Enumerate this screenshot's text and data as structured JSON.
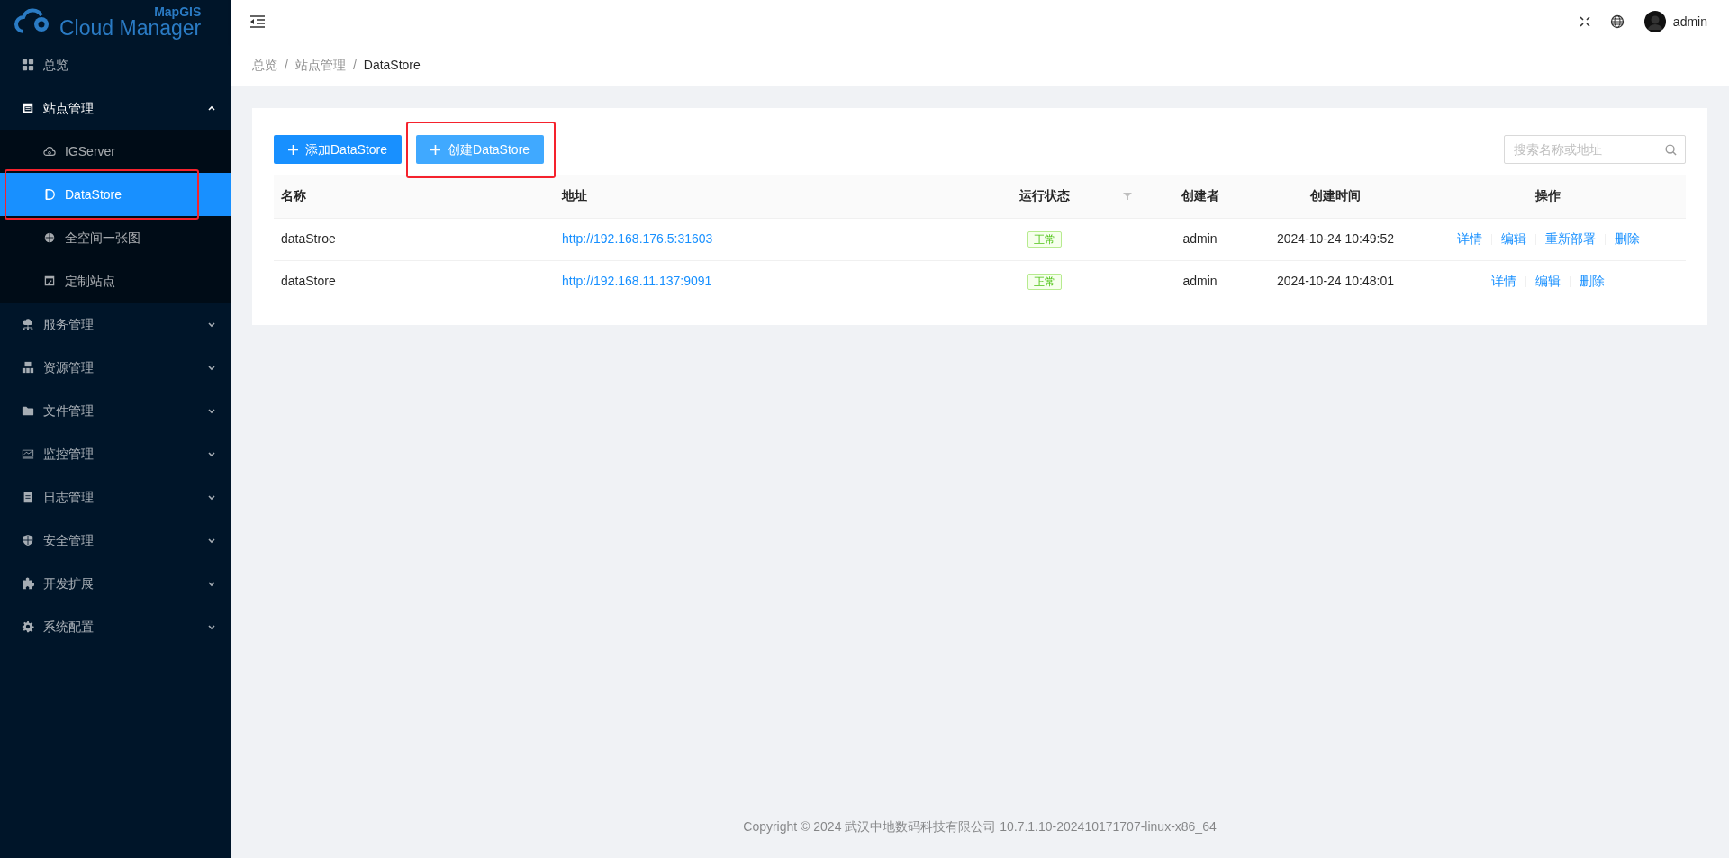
{
  "logo": {
    "brand": "MapGIS",
    "name": "Cloud Manager"
  },
  "sidebar": {
    "items": [
      {
        "label": "总览",
        "kind": "link",
        "selected": false
      },
      {
        "label": "站点管理",
        "kind": "group",
        "expanded": true,
        "children": [
          {
            "label": "IGServer",
            "selected": false,
            "highlighted": false
          },
          {
            "label": "DataStore",
            "selected": true,
            "highlighted": true
          },
          {
            "label": "全空间一张图",
            "selected": false,
            "highlighted": false
          },
          {
            "label": "定制站点",
            "selected": false,
            "highlighted": false
          }
        ]
      },
      {
        "label": "服务管理",
        "kind": "group",
        "expanded": false
      },
      {
        "label": "资源管理",
        "kind": "group",
        "expanded": false
      },
      {
        "label": "文件管理",
        "kind": "group",
        "expanded": false
      },
      {
        "label": "监控管理",
        "kind": "group",
        "expanded": false
      },
      {
        "label": "日志管理",
        "kind": "group",
        "expanded": false
      },
      {
        "label": "安全管理",
        "kind": "group",
        "expanded": false
      },
      {
        "label": "开发扩展",
        "kind": "group",
        "expanded": false
      },
      {
        "label": "系统配置",
        "kind": "group",
        "expanded": false
      }
    ]
  },
  "header": {
    "user": "admin"
  },
  "breadcrumb": {
    "separator": "/",
    "items": [
      "总览",
      "站点管理",
      "DataStore"
    ]
  },
  "toolbar": {
    "buttons": [
      {
        "label": "添加DataStore",
        "hovered": false,
        "highlighted": false
      },
      {
        "label": "创建DataStore",
        "hovered": true,
        "highlighted": true
      }
    ],
    "search": {
      "placeholder": "搜索名称或地址"
    }
  },
  "table": {
    "columns": [
      {
        "label": "名称",
        "filter": false
      },
      {
        "label": "地址",
        "filter": false
      },
      {
        "label": "运行状态",
        "filter": true
      },
      {
        "label": "创建者",
        "filter": false
      },
      {
        "label": "创建时间",
        "filter": false
      },
      {
        "label": "操作",
        "filter": false
      }
    ],
    "rows": [
      {
        "name": "dataStroe",
        "address": "http://192.168.176.5:31603",
        "status": "正常",
        "creator": "admin",
        "created": "2024-10-24 10:49:52",
        "actions": [
          "详情",
          "编辑",
          "重新部署",
          "删除"
        ]
      },
      {
        "name": "dataStore",
        "address": "http://192.168.11.137:9091",
        "status": "正常",
        "creator": "admin",
        "created": "2024-10-24 10:48:01",
        "actions": [
          "详情",
          "编辑",
          "删除"
        ]
      }
    ]
  },
  "footer": "Copyright © 2024 武汉中地数码科技有限公司 10.7.1.10-202410171707-linux-x86_64"
}
